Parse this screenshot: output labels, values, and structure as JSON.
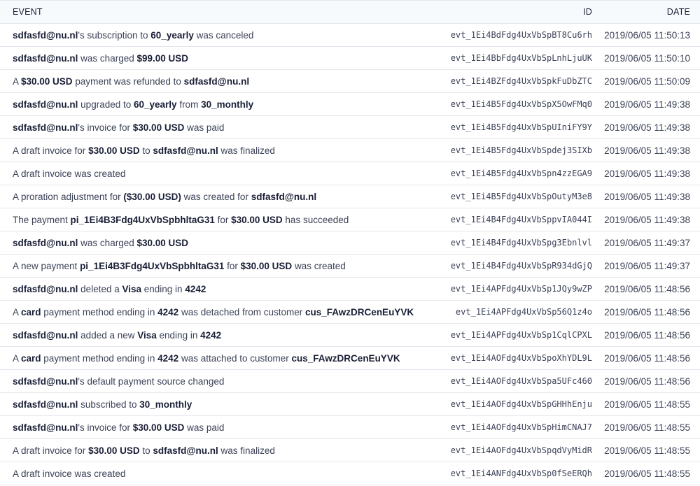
{
  "header": {
    "event_label": "EVENT",
    "id_label": "ID",
    "date_label": "DATE"
  },
  "rows": [
    {
      "segments": [
        [
          "sdfasfd@nu.nl",
          true
        ],
        [
          "'s subscription to ",
          false
        ],
        [
          "60_yearly",
          true
        ],
        [
          " was canceled",
          false
        ]
      ],
      "id": "evt_1Ei4BdFdg4UxVbSpBT8Cu6rh",
      "date": "2019/06/05 11:50:13"
    },
    {
      "segments": [
        [
          "sdfasfd@nu.nl",
          true
        ],
        [
          " was charged ",
          false
        ],
        [
          "$99.00 USD",
          true
        ]
      ],
      "id": "evt_1Ei4BbFdg4UxVbSpLnhLjuUK",
      "date": "2019/06/05 11:50:10"
    },
    {
      "segments": [
        [
          "A ",
          false
        ],
        [
          "$30.00 USD",
          true
        ],
        [
          " payment was refunded to ",
          false
        ],
        [
          "sdfasfd@nu.nl",
          true
        ]
      ],
      "id": "evt_1Ei4BZFdg4UxVbSpkFuDbZTC",
      "date": "2019/06/05 11:50:09"
    },
    {
      "segments": [
        [
          "sdfasfd@nu.nl",
          true
        ],
        [
          " upgraded to ",
          false
        ],
        [
          "60_yearly",
          true
        ],
        [
          " from ",
          false
        ],
        [
          "30_monthly",
          true
        ]
      ],
      "id": "evt_1Ei4B5Fdg4UxVbSpX5OwFMq0",
      "date": "2019/06/05 11:49:38"
    },
    {
      "segments": [
        [
          "sdfasfd@nu.nl",
          true
        ],
        [
          "'s invoice for ",
          false
        ],
        [
          "$30.00 USD",
          true
        ],
        [
          " was paid",
          false
        ]
      ],
      "id": "evt_1Ei4B5Fdg4UxVbSpUIniFY9Y",
      "date": "2019/06/05 11:49:38"
    },
    {
      "segments": [
        [
          "A draft invoice for ",
          false
        ],
        [
          "$30.00 USD",
          true
        ],
        [
          " to ",
          false
        ],
        [
          "sdfasfd@nu.nl",
          true
        ],
        [
          " was finalized",
          false
        ]
      ],
      "id": "evt_1Ei4B5Fdg4UxVbSpdej3SIXb",
      "date": "2019/06/05 11:49:38"
    },
    {
      "segments": [
        [
          "A draft invoice was created",
          false
        ]
      ],
      "id": "evt_1Ei4B5Fdg4UxVbSpn4zzEGA9",
      "date": "2019/06/05 11:49:38"
    },
    {
      "segments": [
        [
          "A proration adjustment for ",
          false
        ],
        [
          "($30.00 USD)",
          true
        ],
        [
          " was created for ",
          false
        ],
        [
          "sdfasfd@nu.nl",
          true
        ]
      ],
      "id": "evt_1Ei4B5Fdg4UxVbSpOutyM3e8",
      "date": "2019/06/05 11:49:38"
    },
    {
      "segments": [
        [
          "The payment ",
          false
        ],
        [
          "pi_1Ei4B3Fdg4UxVbSpbhltaG31",
          true
        ],
        [
          " for ",
          false
        ],
        [
          "$30.00 USD",
          true
        ],
        [
          " has succeeded",
          false
        ]
      ],
      "id": "evt_1Ei4B4Fdg4UxVbSppvIA044I",
      "date": "2019/06/05 11:49:38"
    },
    {
      "segments": [
        [
          "sdfasfd@nu.nl",
          true
        ],
        [
          " was charged ",
          false
        ],
        [
          "$30.00 USD",
          true
        ]
      ],
      "id": "evt_1Ei4B4Fdg4UxVbSpg3Ebnlvl",
      "date": "2019/06/05 11:49:37"
    },
    {
      "segments": [
        [
          "A new payment ",
          false
        ],
        [
          "pi_1Ei4B3Fdg4UxVbSpbhltaG31",
          true
        ],
        [
          " for ",
          false
        ],
        [
          "$30.00 USD",
          true
        ],
        [
          " was created",
          false
        ]
      ],
      "id": "evt_1Ei4B4Fdg4UxVbSpR934dGjQ",
      "date": "2019/06/05 11:49:37"
    },
    {
      "segments": [
        [
          "sdfasfd@nu.nl",
          true
        ],
        [
          " deleted a ",
          false
        ],
        [
          "Visa",
          true
        ],
        [
          " ending in ",
          false
        ],
        [
          "4242",
          true
        ]
      ],
      "id": "evt_1Ei4APFdg4UxVbSp1JQy9wZP",
      "date": "2019/06/05 11:48:56"
    },
    {
      "segments": [
        [
          "A ",
          false
        ],
        [
          "card",
          true
        ],
        [
          " payment method ending in ",
          false
        ],
        [
          "4242",
          true
        ],
        [
          " was detached from customer ",
          false
        ],
        [
          "cus_FAwzDRCenEuYVK",
          true
        ]
      ],
      "id": "evt_1Ei4APFdg4UxVbSp56Q1z4o",
      "date": "2019/06/05 11:48:56"
    },
    {
      "segments": [
        [
          "sdfasfd@nu.nl",
          true
        ],
        [
          " added a new ",
          false
        ],
        [
          "Visa",
          true
        ],
        [
          " ending in ",
          false
        ],
        [
          "4242",
          true
        ]
      ],
      "id": "evt_1Ei4APFdg4UxVbSp1CqlCPXL",
      "date": "2019/06/05 11:48:56"
    },
    {
      "segments": [
        [
          "A ",
          false
        ],
        [
          "card",
          true
        ],
        [
          " payment method ending in ",
          false
        ],
        [
          "4242",
          true
        ],
        [
          " was attached to customer ",
          false
        ],
        [
          "cus_FAwzDRCenEuYVK",
          true
        ]
      ],
      "id": "evt_1Ei4AOFdg4UxVbSpoXhYDL9L",
      "date": "2019/06/05 11:48:56"
    },
    {
      "segments": [
        [
          "sdfasfd@nu.nl",
          true
        ],
        [
          "'s default payment source changed",
          false
        ]
      ],
      "id": "evt_1Ei4AOFdg4UxVbSpa5UFc460",
      "date": "2019/06/05 11:48:56"
    },
    {
      "segments": [
        [
          "sdfasfd@nu.nl",
          true
        ],
        [
          " subscribed to ",
          false
        ],
        [
          "30_monthly",
          true
        ]
      ],
      "id": "evt_1Ei4AOFdg4UxVbSpGHHhEnju",
      "date": "2019/06/05 11:48:55"
    },
    {
      "segments": [
        [
          "sdfasfd@nu.nl",
          true
        ],
        [
          "'s invoice for ",
          false
        ],
        [
          "$30.00 USD",
          true
        ],
        [
          " was paid",
          false
        ]
      ],
      "id": "evt_1Ei4AOFdg4UxVbSpHimCNAJ7",
      "date": "2019/06/05 11:48:55"
    },
    {
      "segments": [
        [
          "A draft invoice for ",
          false
        ],
        [
          "$30.00 USD",
          true
        ],
        [
          " to ",
          false
        ],
        [
          "sdfasfd@nu.nl",
          true
        ],
        [
          " was finalized",
          false
        ]
      ],
      "id": "evt_1Ei4AOFdg4UxVbSpqdVyMidR",
      "date": "2019/06/05 11:48:55"
    },
    {
      "segments": [
        [
          "A draft invoice was created",
          false
        ]
      ],
      "id": "evt_1Ei4ANFdg4UxVbSp0fSeERQh",
      "date": "2019/06/05 11:48:55"
    }
  ]
}
